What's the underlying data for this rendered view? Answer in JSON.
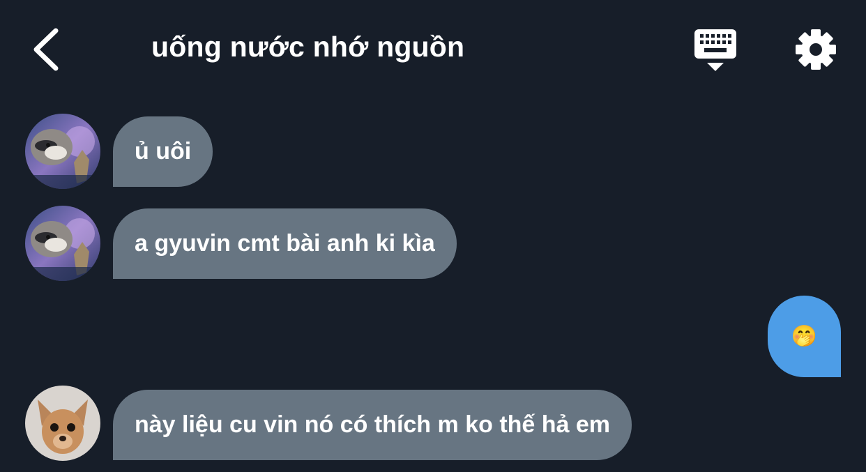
{
  "header": {
    "title": "uống nước nhớ nguồn",
    "back_icon": "chevron-left-icon",
    "keyboard_icon": "keyboard-hide-icon",
    "settings_icon": "gear-icon"
  },
  "messages": [
    {
      "direction": "incoming",
      "text": "ủ uôi",
      "avatar": "raccoon-meme-avatar"
    },
    {
      "direction": "incoming",
      "text": "a gyuvin cmt bài anh ki kìa",
      "avatar": "raccoon-meme-avatar"
    },
    {
      "direction": "outgoing",
      "text": "🤭"
    },
    {
      "direction": "incoming",
      "text": "này liệu cu vin nó có thích m ko thế hả em",
      "avatar": "chihuahua-avatar"
    }
  ],
  "colors": {
    "background": "#171e29",
    "incoming_bubble": "#677582",
    "outgoing_bubble": "#4d9de7",
    "text": "#ffffff"
  }
}
